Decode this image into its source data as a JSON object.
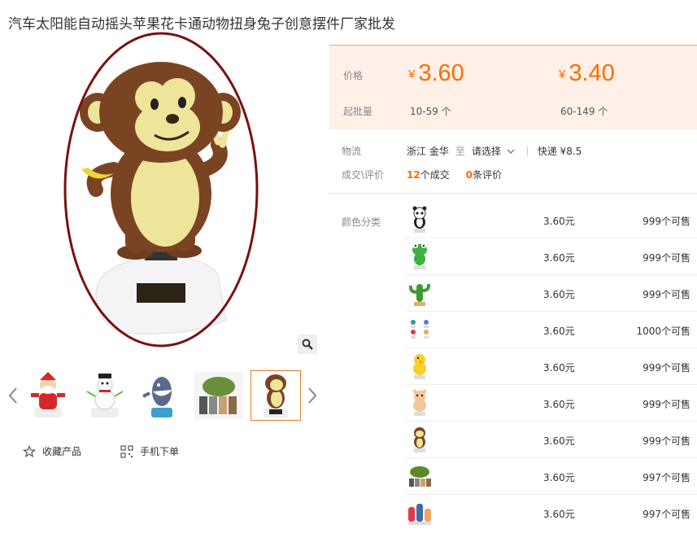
{
  "product": {
    "title": "汽车太阳能自动摇头苹果花卡通动物扭身兔子创意摆件厂家批发"
  },
  "gallery": {
    "thumbnails": [
      {
        "name": "santa-thumbnail",
        "color": "#d62828"
      },
      {
        "name": "snowman-thumbnail",
        "color": "#ffffff"
      },
      {
        "name": "shark-thumbnail",
        "color": "#3a6ea5"
      },
      {
        "name": "group-thumbnail",
        "color": "#6a8f3a"
      },
      {
        "name": "monkey-thumbnail",
        "color": "#7a4a2a"
      }
    ],
    "active_index": 4
  },
  "actions": {
    "favorite_label": "收藏产品",
    "mobile_order_label": "手机下单"
  },
  "pricing": {
    "price_label": "价格",
    "min_qty_label": "起批量",
    "currency": "¥",
    "tiers": [
      {
        "price": "3.60",
        "qty": "10-59 个"
      },
      {
        "price": "3.40",
        "qty": "60-149 个"
      }
    ],
    "accent_color": "#ff6a00"
  },
  "logistics": {
    "label": "物流",
    "origin": "浙江 金华",
    "to": "至",
    "destination": "请选择",
    "express": "快递 ¥8.5"
  },
  "deals": {
    "label": "成交\\评价",
    "count": "12",
    "count_suffix": "个成交",
    "reviews": "0",
    "reviews_suffix": "条评价"
  },
  "sku": {
    "label": "颜色分类",
    "items": [
      {
        "icon": "panda",
        "price": "3.60元",
        "stock": "999个可售"
      },
      {
        "icon": "frog",
        "price": "3.60元",
        "stock": "999个可售"
      },
      {
        "icon": "cactus",
        "price": "3.60元",
        "stock": "999个可售"
      },
      {
        "icon": "birds",
        "price": "3.60元",
        "stock": "1000个可售"
      },
      {
        "icon": "chick",
        "price": "3.60元",
        "stock": "999个可售"
      },
      {
        "icon": "bear",
        "price": "3.60元",
        "stock": "999个可售"
      },
      {
        "icon": "monkey",
        "price": "3.60元",
        "stock": "999个可售"
      },
      {
        "icon": "group",
        "price": "3.60元",
        "stock": "997个可售"
      },
      {
        "icon": "family",
        "price": "3.60元",
        "stock": "997个可售"
      }
    ]
  }
}
